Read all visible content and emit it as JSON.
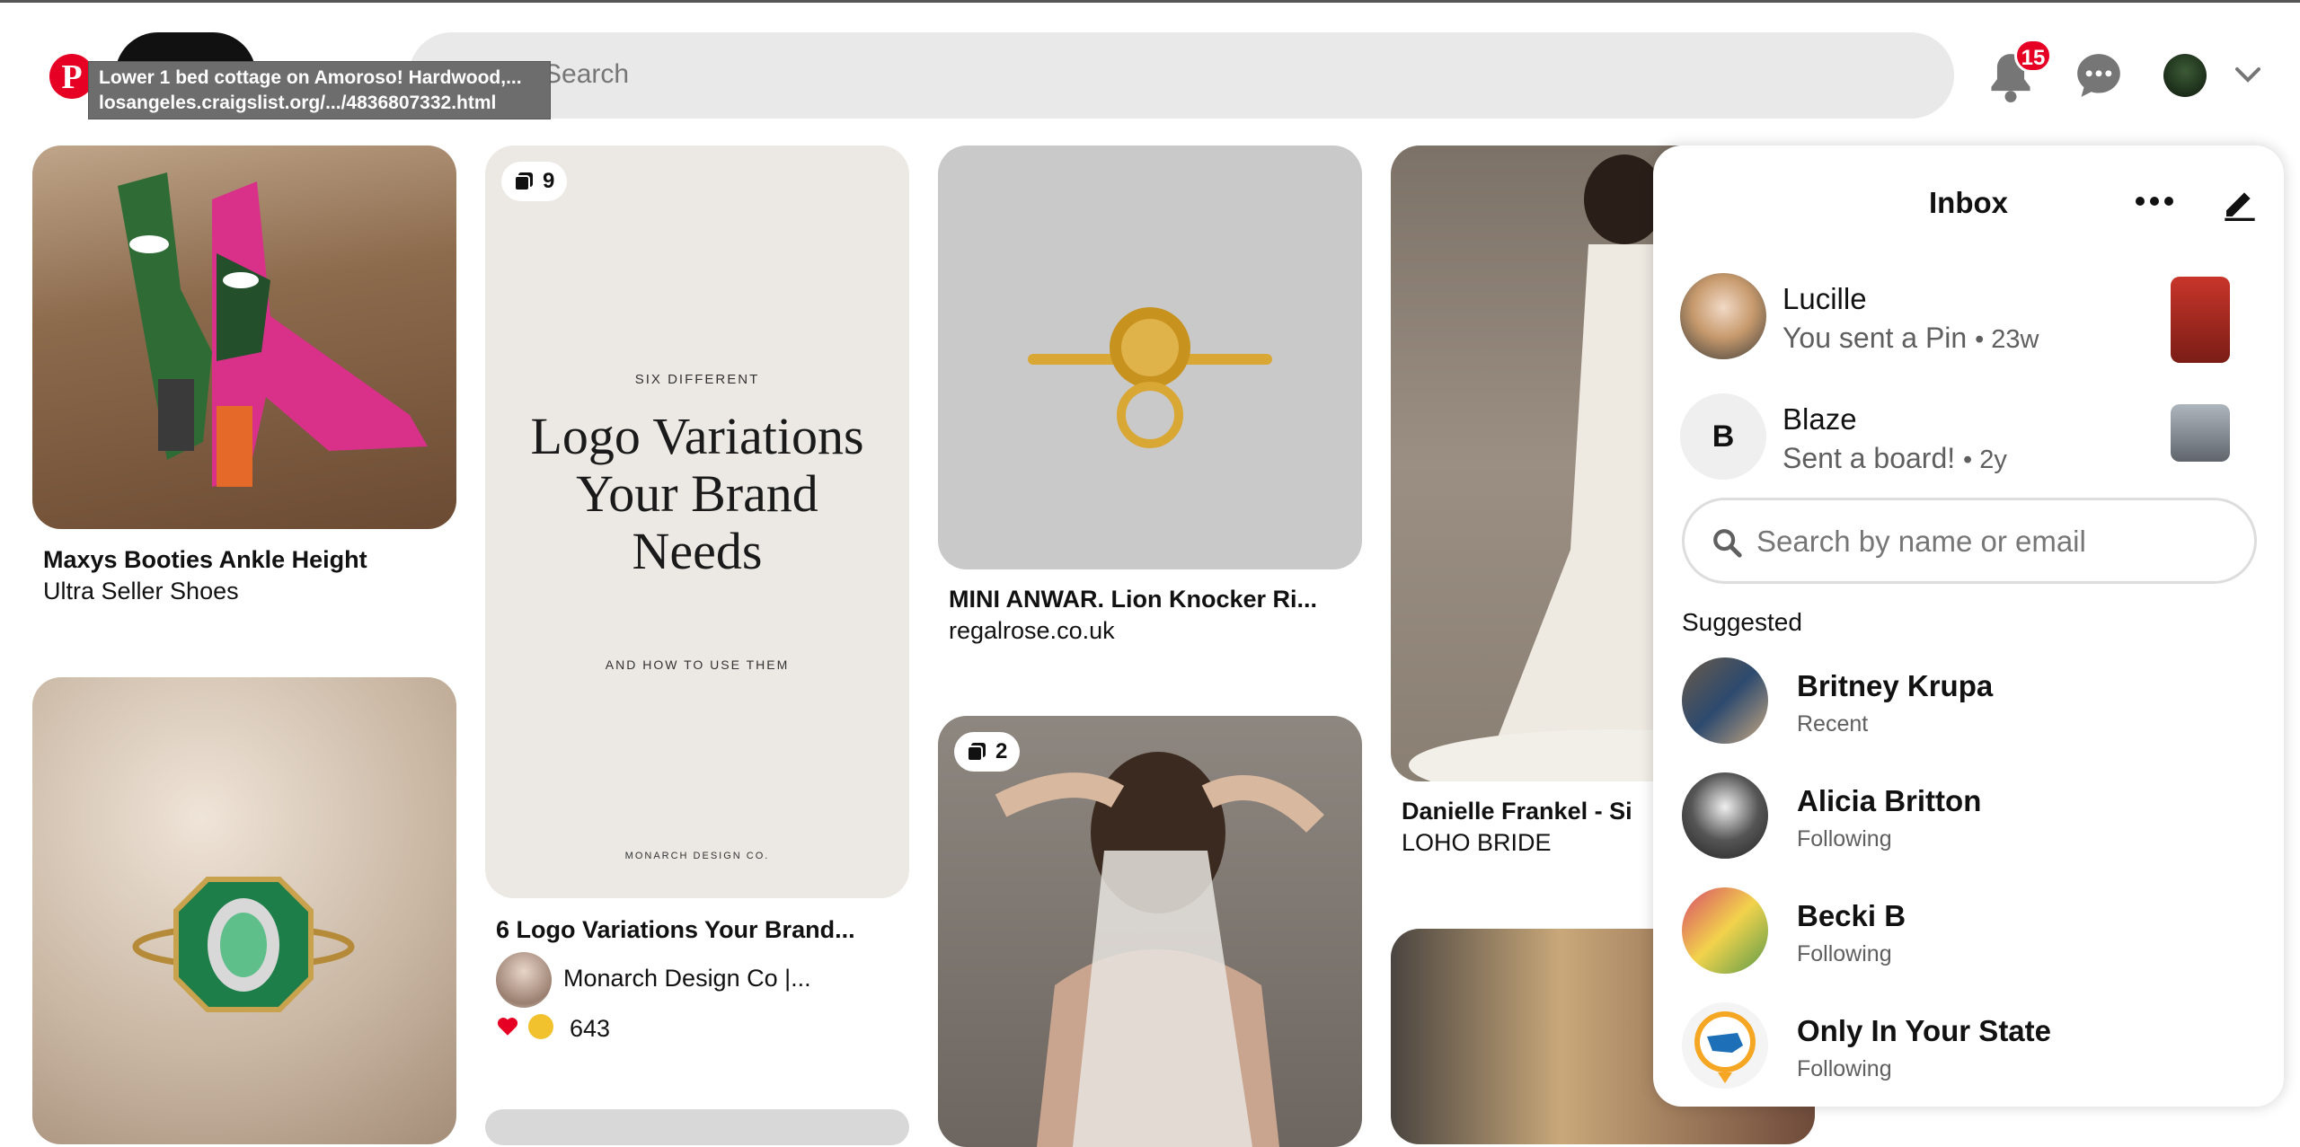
{
  "header": {
    "logo": "P",
    "search_placeholder": "Search",
    "notification_count": "15",
    "tooltip": {
      "title": "Lower 1 bed cottage on Amoroso! Hardwood,...",
      "url": "losangeles.craigslist.org/.../4836807332.html"
    }
  },
  "pins": [
    {
      "title": "Maxys Booties Ankle Height",
      "subtitle": "Ultra Seller Shoes"
    },
    {
      "title": "6 Logo Variations Your Brand...",
      "subtitle": "Monarch Design Co |...",
      "badge": "9",
      "reactions": "643",
      "image_text": {
        "top": "SIX DIFFERENT",
        "main": "Logo Variations Your Brand Needs",
        "sub": "AND HOW TO USE THEM",
        "footer": "MONARCH DESIGN CO."
      }
    },
    {
      "title": "MINI ANWAR. Lion Knocker Ri...",
      "subtitle": "regalrose.co.uk"
    },
    {
      "title": "Danielle Frankel - Si",
      "subtitle": "LOHO BRIDE"
    },
    {
      "badge": "2"
    }
  ],
  "inbox": {
    "title": "Inbox",
    "conversations": [
      {
        "name": "Lucille",
        "message": "You sent a Pin",
        "time": "• 23w"
      },
      {
        "name": "Blaze",
        "initial": "B",
        "message": "Sent a board!",
        "time": "• 2y"
      }
    ],
    "search_placeholder": "Search by name or email",
    "suggested_label": "Suggested",
    "suggested": [
      {
        "name": "Britney Krupa",
        "sub": "Recent"
      },
      {
        "name": "Alicia Britton",
        "sub": "Following"
      },
      {
        "name": "Becki B",
        "sub": "Following"
      },
      {
        "name": "Only In Your State",
        "sub": "Following"
      }
    ]
  },
  "icons": {
    "logo": "pinterest-logo-icon",
    "notifications": "bell-icon",
    "messages": "chat-bubble-icon",
    "account_menu": "chevron-down-icon",
    "more": "ellipsis-icon",
    "compose": "pencil-icon",
    "search": "search-icon",
    "board_count": "stack-icon"
  },
  "colors": {
    "brand": "#e60023",
    "search_bg": "#e9e9e9",
    "muted_text": "#5f5f5f"
  }
}
